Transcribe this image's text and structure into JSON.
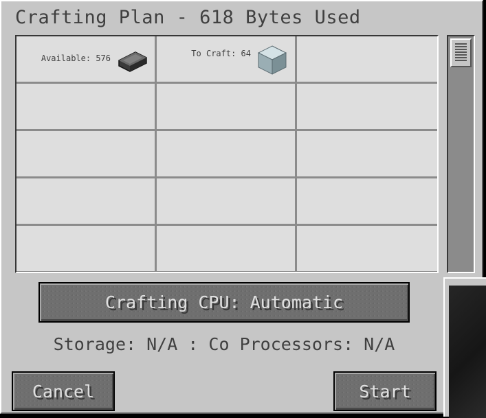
{
  "window": {
    "title": "Crafting Plan - 618 Bytes Used"
  },
  "grid": {
    "cells": [
      {
        "label": "Available: 576",
        "icon": "iron-ingot-icon"
      },
      {
        "label": "To Craft: 64",
        "icon": "block-icon"
      },
      {
        "label": ""
      },
      {
        "label": ""
      },
      {
        "label": ""
      },
      {
        "label": ""
      },
      {
        "label": ""
      },
      {
        "label": ""
      },
      {
        "label": ""
      },
      {
        "label": ""
      },
      {
        "label": ""
      },
      {
        "label": ""
      },
      {
        "label": ""
      },
      {
        "label": ""
      },
      {
        "label": ""
      }
    ]
  },
  "cpu_button": {
    "label": "Crafting CPU: Automatic"
  },
  "status": {
    "text": "Storage: N/A : Co Processors: N/A"
  },
  "buttons": {
    "cancel": "Cancel",
    "start": "Start"
  },
  "colors": {
    "panel": "#c6c6c6",
    "grid_bg": "#dedede",
    "button": "#6f6f6f",
    "text_dark": "#404040",
    "text_light": "#e0e0e0"
  }
}
